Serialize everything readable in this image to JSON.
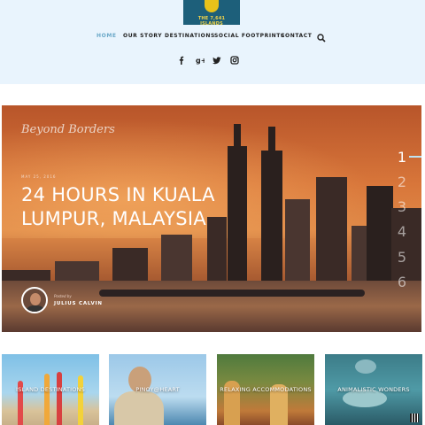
{
  "header": {
    "logo_text": "THE 7,641 ISLANDS",
    "nav": [
      {
        "label": "HOME",
        "active": true
      },
      {
        "label": "OUR STORY",
        "active": false
      },
      {
        "label": "DESTINATIONS",
        "active": false
      },
      {
        "label": "SOCIAL FOOTPRINTS",
        "active": false
      },
      {
        "label": "CONTACT",
        "active": false
      }
    ],
    "search_icon": "search-icon",
    "social_icons": [
      "facebook-icon",
      "google-plus-icon",
      "twitter-icon",
      "instagram-icon"
    ],
    "background_color": "#e9f4fd",
    "active_color": "#6aa8c8"
  },
  "hero": {
    "blog_name": "Beyond Borders",
    "date": "MAY 25, 2016",
    "title": "24 HOURS IN KUALA LUMPUR, MALAYSIA",
    "posted_by": "Posted by",
    "author": "JULIUS CALVIN",
    "slides": [
      "1",
      "2",
      "3",
      "4",
      "5",
      "6"
    ],
    "active_slide": 1
  },
  "cards": [
    {
      "label": "ISLAND DESTINATIONS"
    },
    {
      "label": "PINOY@HEART"
    },
    {
      "label": "RELAXING ACCOMMODATIONS"
    },
    {
      "label": "ANIMALISTIC WONDERS"
    }
  ]
}
